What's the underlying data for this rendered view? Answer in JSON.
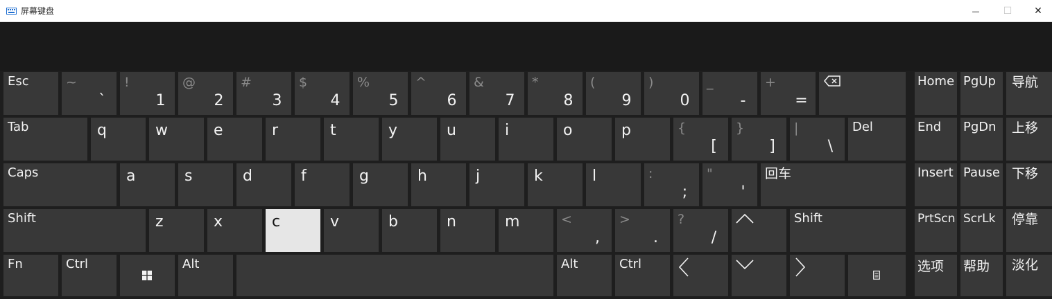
{
  "window": {
    "title": "屏幕键盘",
    "icons": {
      "app": "keyboard-icon",
      "minimize": "minimize-icon",
      "maximize": "maximize-icon",
      "close": "close-icon"
    }
  },
  "glyphs": {
    "minimize": "—",
    "maximize": "☐",
    "close": "✕"
  },
  "keys": {
    "esc": "Esc",
    "n1": {
      "shift": "~",
      "main": "`"
    },
    "n2": {
      "shift": "!",
      "main": "1"
    },
    "n3": {
      "shift": "@",
      "main": "2"
    },
    "n4": {
      "shift": "#",
      "main": "3"
    },
    "n5": {
      "shift": "$",
      "main": "4"
    },
    "n6": {
      "shift": "%",
      "main": "5"
    },
    "n7": {
      "shift": "^",
      "main": "6"
    },
    "n8": {
      "shift": "&",
      "main": "7"
    },
    "n9": {
      "shift": "*",
      "main": "8"
    },
    "n10": {
      "shift": "(",
      "main": "9"
    },
    "n11": {
      "shift": ")",
      "main": "0"
    },
    "n12": {
      "shift": "_",
      "main": "-"
    },
    "n13": {
      "shift": "+",
      "main": "="
    },
    "home": "Home",
    "pgup": "PgUp",
    "nav": "导航",
    "tab": "Tab",
    "q": "q",
    "w": "w",
    "e": "e",
    "r": "r",
    "t": "t",
    "y": "y",
    "u": "u",
    "i": "i",
    "o": "o",
    "p": "p",
    "lbracket": {
      "shift": "{",
      "main": "["
    },
    "rbracket": {
      "shift": "}",
      "main": "]"
    },
    "backslash": {
      "shift": "|",
      "main": "\\"
    },
    "del": "Del",
    "end": "End",
    "pgdn": "PgDn",
    "moveup": "上移",
    "caps": "Caps",
    "a": "a",
    "s": "s",
    "d": "d",
    "f": "f",
    "g": "g",
    "h": "h",
    "j": "j",
    "k": "k",
    "l": "l",
    "semicolon": {
      "shift": ":",
      "main": ";"
    },
    "quote": {
      "shift": "\"",
      "main": "'"
    },
    "enter": "回车",
    "insert": "Insert",
    "pause": "Pause",
    "movedown": "下移",
    "shift_l": "Shift",
    "z": "z",
    "x": "x",
    "c": "c",
    "v": "v",
    "b": "b",
    "n": "n",
    "m": "m",
    "comma": {
      "shift": "<",
      "main": ","
    },
    "period": {
      "shift": ">",
      "main": "."
    },
    "slash": {
      "shift": "?",
      "main": "/"
    },
    "shift_r": "Shift",
    "prtscn": "PrtScn",
    "scrlk": "ScrLk",
    "dock": "停靠",
    "fn": "Fn",
    "ctrl_l": "Ctrl",
    "alt_l": "Alt",
    "alt_r": "Alt",
    "ctrl_r": "Ctrl",
    "options": "选项",
    "help": "帮助",
    "fade": "淡化"
  },
  "icons": {
    "backspace": "backspace-icon",
    "up": "arrow-up-icon",
    "left": "arrow-left-icon",
    "down": "arrow-down-icon",
    "right": "arrow-right-icon",
    "windows": "windows-logo-icon",
    "menu": "context-menu-icon"
  },
  "colors": {
    "key": "#383838",
    "active": "#e6e6e6",
    "background": "#1e1e1e",
    "shift_text": "#8a8a8a"
  },
  "state": {
    "pressed_key": "c"
  }
}
